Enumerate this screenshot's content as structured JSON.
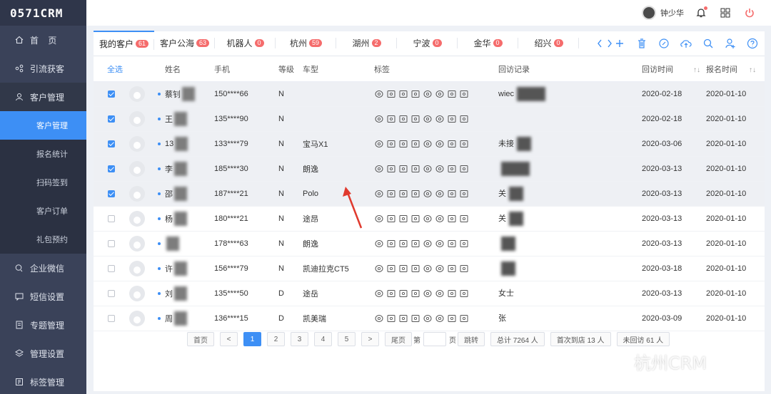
{
  "app": {
    "logo": "0571CRM"
  },
  "sidebar": {
    "items": [
      {
        "label": "首    页",
        "icon": "home-icon"
      },
      {
        "label": "引流获客",
        "icon": "share-icon"
      },
      {
        "label": "客户管理",
        "icon": "user-icon",
        "open": true,
        "children": [
          {
            "label": "客户管理",
            "active": true
          },
          {
            "label": "报名统计"
          },
          {
            "label": "扫码签到"
          },
          {
            "label": "客户订单"
          },
          {
            "label": "礼包预约"
          }
        ]
      },
      {
        "label": "企业微信",
        "icon": "chat-icon"
      },
      {
        "label": "短信设置",
        "icon": "message-icon"
      },
      {
        "label": "专题管理",
        "icon": "topic-icon"
      },
      {
        "label": "管理设置",
        "icon": "layers-icon"
      },
      {
        "label": "标签管理",
        "icon": "tag-icon"
      }
    ]
  },
  "header": {
    "username": "钟少华"
  },
  "tabs": [
    {
      "label": "我的客户",
      "count": "61",
      "active": true
    },
    {
      "label": "客户公海",
      "count": "63"
    },
    {
      "label": "机器人",
      "count": "0"
    },
    {
      "label": "杭州",
      "count": "59"
    },
    {
      "label": "湖州",
      "count": "2"
    },
    {
      "label": "宁波",
      "count": "0"
    },
    {
      "label": "金华",
      "count": "0"
    },
    {
      "label": "绍兴",
      "count": "0"
    }
  ],
  "table": {
    "headers": {
      "select_all": "全选",
      "name": "姓名",
      "phone": "手机",
      "level": "等级",
      "car": "车型",
      "tags": "标签",
      "record": "回访记录",
      "visit": "回访时间",
      "register": "报名时间",
      "sort": "↑↓"
    },
    "rows": [
      {
        "checked": true,
        "name": "蔡钊",
        "phone": "150****66",
        "level": "N",
        "car": "",
        "record": "wiec",
        "visit": "2020-02-18",
        "register": "2020-01-10"
      },
      {
        "checked": true,
        "name": "王",
        "phone": "135****90",
        "level": "N",
        "car": "",
        "record": "",
        "visit": "2020-02-18",
        "register": "2020-01-10"
      },
      {
        "checked": true,
        "name": "13",
        "phone": "133****79",
        "level": "N",
        "car": "宝马X1",
        "record": "未接",
        "visit": "2020-03-06",
        "register": "2020-01-10"
      },
      {
        "checked": true,
        "name": "李",
        "phone": "185****30",
        "level": "N",
        "car": "朗逸",
        "record": "",
        "visit": "2020-03-13",
        "register": "2020-01-10"
      },
      {
        "checked": true,
        "name": "邵",
        "phone": "187****21",
        "level": "N",
        "car": "Polo",
        "record": "关",
        "visit": "2020-03-13",
        "register": "2020-01-10"
      },
      {
        "checked": false,
        "name": "杨",
        "phone": "180****21",
        "level": "N",
        "car": "途昂",
        "record": "关",
        "visit": "2020-03-13",
        "register": "2020-01-10"
      },
      {
        "checked": false,
        "name": "",
        "phone": "178****63",
        "level": "N",
        "car": "朗逸",
        "record": "",
        "visit": "2020-03-13",
        "register": "2020-01-10"
      },
      {
        "checked": false,
        "name": "许",
        "phone": "156****79",
        "level": "N",
        "car": "凯迪拉克CT5",
        "record": "",
        "visit": "2020-03-18",
        "register": "2020-01-10"
      },
      {
        "checked": false,
        "name": "刘",
        "phone": "135****50",
        "level": "D",
        "car": "途岳",
        "record": "女士",
        "visit": "2020-03-13",
        "register": "2020-01-10"
      },
      {
        "checked": false,
        "name": "周",
        "phone": "136****15",
        "level": "D",
        "car": "凯美瑞",
        "record": "张",
        "visit": "2020-03-09",
        "register": "2020-01-10"
      }
    ]
  },
  "pager": {
    "first": "首页",
    "prev": "<",
    "pages": [
      "1",
      "2",
      "3",
      "4",
      "5"
    ],
    "current": "1",
    "next": ">",
    "last": "尾页",
    "go_prefix": "第",
    "go_suffix": "页",
    "jump": "跳转",
    "total": "总计 7264 人",
    "first_visit": "首次到店 13 人",
    "not_visited": "未回访 61 人"
  },
  "watermark": "杭州CRM",
  "colors": {
    "primary": "#3d8ff5",
    "sidebar": "#3a4259",
    "badge": "#f56c6c"
  }
}
